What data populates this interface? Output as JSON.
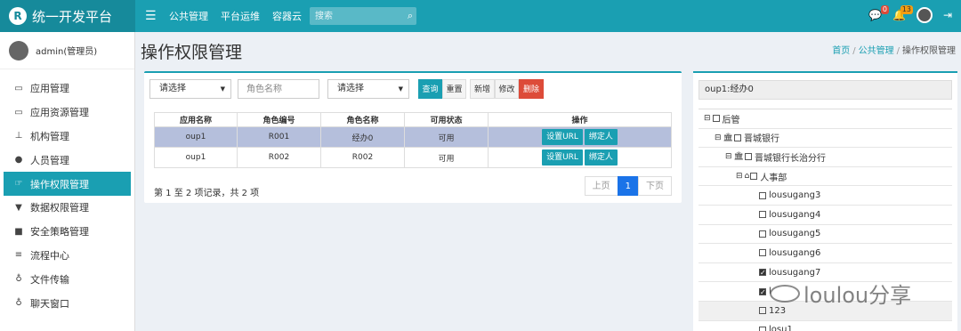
{
  "brand": {
    "logo_letter": "R",
    "title": "统一开发平台"
  },
  "topnav": {
    "items": [
      "公共管理",
      "平台运维",
      "容器云"
    ]
  },
  "search": {
    "placeholder": "搜索"
  },
  "topbar": {
    "messages_badge": "0",
    "notices_badge": "13"
  },
  "user": {
    "name": "admin(管理员)"
  },
  "sidebar": {
    "items": [
      {
        "label": "应用管理",
        "icon": "monitor-icon"
      },
      {
        "label": "应用资源管理",
        "icon": "monitor-icon"
      },
      {
        "label": "机构管理",
        "icon": "org-tree-icon"
      },
      {
        "label": "人员管理",
        "icon": "users-icon"
      },
      {
        "label": "操作权限管理",
        "icon": "hand-point-icon",
        "active": true
      },
      {
        "label": "数据权限管理",
        "icon": "filter-icon"
      },
      {
        "label": "安全策略管理",
        "icon": "lock-icon"
      },
      {
        "label": "流程中心",
        "icon": "sliders-icon"
      },
      {
        "label": "文件传输",
        "icon": "transfer-icon"
      },
      {
        "label": "聊天窗口",
        "icon": "chat-icon"
      }
    ]
  },
  "page": {
    "title": "操作权限管理",
    "breadcrumb": [
      "首页",
      "公共管理",
      "操作权限管理"
    ]
  },
  "filters": {
    "app_select": "请选择",
    "role_name_placeholder": "角色名称",
    "status_select": "请选择",
    "buttons": {
      "query": "查询",
      "reset": "重置",
      "add": "新增",
      "edit": "修改",
      "delete": "删除"
    }
  },
  "table": {
    "headers": [
      "应用名称",
      "角色编号",
      "角色名称",
      "可用状态",
      "操作"
    ],
    "rows": [
      {
        "app": "oup1",
        "code": "R001",
        "name": "经办0",
        "status": "可用",
        "selected": true
      },
      {
        "app": "oup1",
        "code": "R002",
        "name": "R002",
        "status": "可用",
        "selected": false
      }
    ],
    "row_actions": {
      "set_url": "设置URL",
      "bind_user": "绑定人"
    }
  },
  "pagination": {
    "info": "第 1 至 2 项记录，共 2 项",
    "prev": "上页",
    "current": "1",
    "next": "下页"
  },
  "tree_panel": {
    "selected_role": "oup1:经办0",
    "nodes": [
      {
        "label": "后管",
        "toggle": "⊟",
        "checked": false,
        "bank": false
      },
      {
        "label": "晋城银行",
        "toggle": "⊟",
        "checked": false,
        "bank": true
      },
      {
        "label": "晋城银行长治分行",
        "toggle": "⊟",
        "checked": false,
        "bank": true
      },
      {
        "label": "人事部",
        "toggle": "⊟",
        "checked": false,
        "bank": false
      },
      {
        "label": "lousugang3",
        "checked": false
      },
      {
        "label": "lousugang4",
        "checked": false
      },
      {
        "label": "lousugang5",
        "checked": false
      },
      {
        "label": "lousugang6",
        "checked": false
      },
      {
        "label": "lousugang7",
        "checked": true
      },
      {
        "label": "l",
        "checked": true
      },
      {
        "label": "123",
        "checked": false,
        "highlight": true
      },
      {
        "label": "losu1",
        "checked": false
      }
    ]
  },
  "watermark": {
    "text": "loulou分享"
  },
  "colors": {
    "primary": "#1a9fb2",
    "danger": "#dd4b39",
    "selected_row": "#b5bfdc",
    "page_active": "#1a73e8"
  }
}
